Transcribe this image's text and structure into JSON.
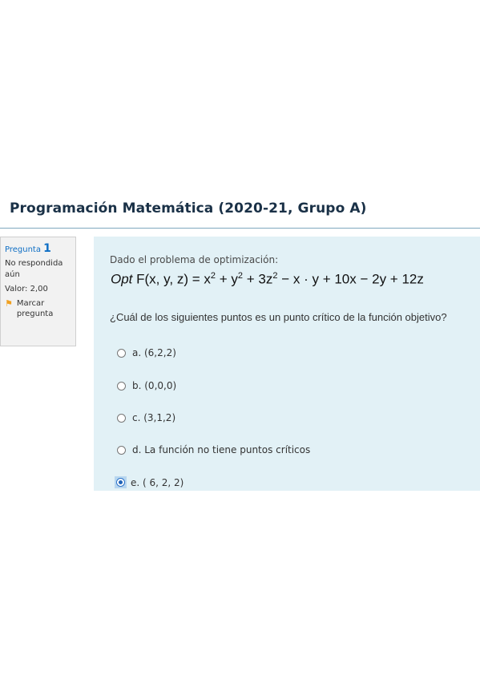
{
  "page": {
    "title": "Programación Matemática (2020-21, Grupo A)"
  },
  "info": {
    "question_label": "Pregunta",
    "question_number": "1",
    "status_line1": "No respondida",
    "status_line2": "aún",
    "value": "Valor: 2,00",
    "flag_line1": "Marcar",
    "flag_line2": "pregunta",
    "flag_icon": "flag-icon"
  },
  "question": {
    "intro": "Dado el problema de optimización:",
    "formula": {
      "prefix": "Opt",
      "func": "F(x, y, z) =",
      "t1": "x",
      "t2": "+ y",
      "t3": "+ 3z",
      "exp": "2",
      "rest": "− x · y + 10x − 2y + 12z"
    },
    "prompt": "¿Cuál de los siguientes puntos es un punto crítico de la función objetivo?",
    "options": [
      {
        "label": "a. (6,2,2)",
        "selected": false
      },
      {
        "label": "b. (0,0,0)",
        "selected": false
      },
      {
        "label": "c. (3,1,2)",
        "selected": false
      },
      {
        "label": "d. La función no tiene puntos críticos",
        "selected": false
      },
      {
        "label": "e. ( 6,  2,  2)",
        "selected": true
      }
    ]
  },
  "colors": {
    "accent": "#0f6fc5",
    "content_bg": "#e2f1f6",
    "info_bg": "#f2f2f2"
  }
}
